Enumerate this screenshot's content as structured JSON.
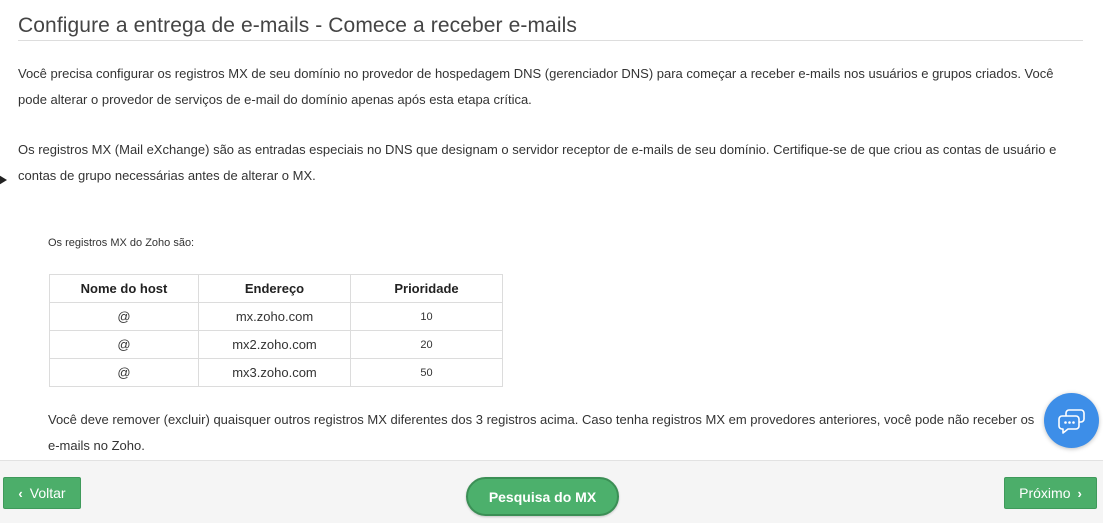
{
  "header": {
    "title": "Configure a entrega de e-mails - Comece a receber e-mails"
  },
  "intro": {
    "paragraph1": "Você precisa configurar os registros MX de seu domínio no provedor de hospedagem DNS (gerenciador DNS) para começar a receber e-mails nos usuários e grupos criados. Você pode alterar o provedor de serviços de e-mail do domínio apenas após esta etapa crítica.",
    "paragraph2": "Os registros MX (Mail eXchange) são as entradas especiais no DNS que designam o servidor receptor de e-mails de seu domínio. Certifique-se de que criou as contas de usuário e contas de grupo necessárias antes de alterar o MX."
  },
  "mx_section": {
    "label": "Os registros MX do Zoho são:",
    "columns": [
      "Nome do host",
      "Endereço",
      "Prioridade"
    ],
    "rows": [
      {
        "host": "@",
        "address": "mx.zoho.com",
        "priority": "10"
      },
      {
        "host": "@",
        "address": "mx2.zoho.com",
        "priority": "20"
      },
      {
        "host": "@",
        "address": "mx3.zoho.com",
        "priority": "50"
      }
    ],
    "warning": "Você deve remover (excluir) quaisquer outros registros MX diferentes dos 3 registros acima. Caso tenha registros MX em provedores anteriores, você pode não receber os e-mails no Zoho."
  },
  "footer": {
    "back_label": "Voltar",
    "mx_lookup_label": "Pesquisa do MX",
    "next_label": "Próximo"
  },
  "icons": {
    "chat": "chat-bubble-icon",
    "back": "chevron-left-icon",
    "next": "chevron-right-icon"
  },
  "colors": {
    "primary_green": "#4cae6a",
    "chat_blue": "#3d8ee8"
  }
}
